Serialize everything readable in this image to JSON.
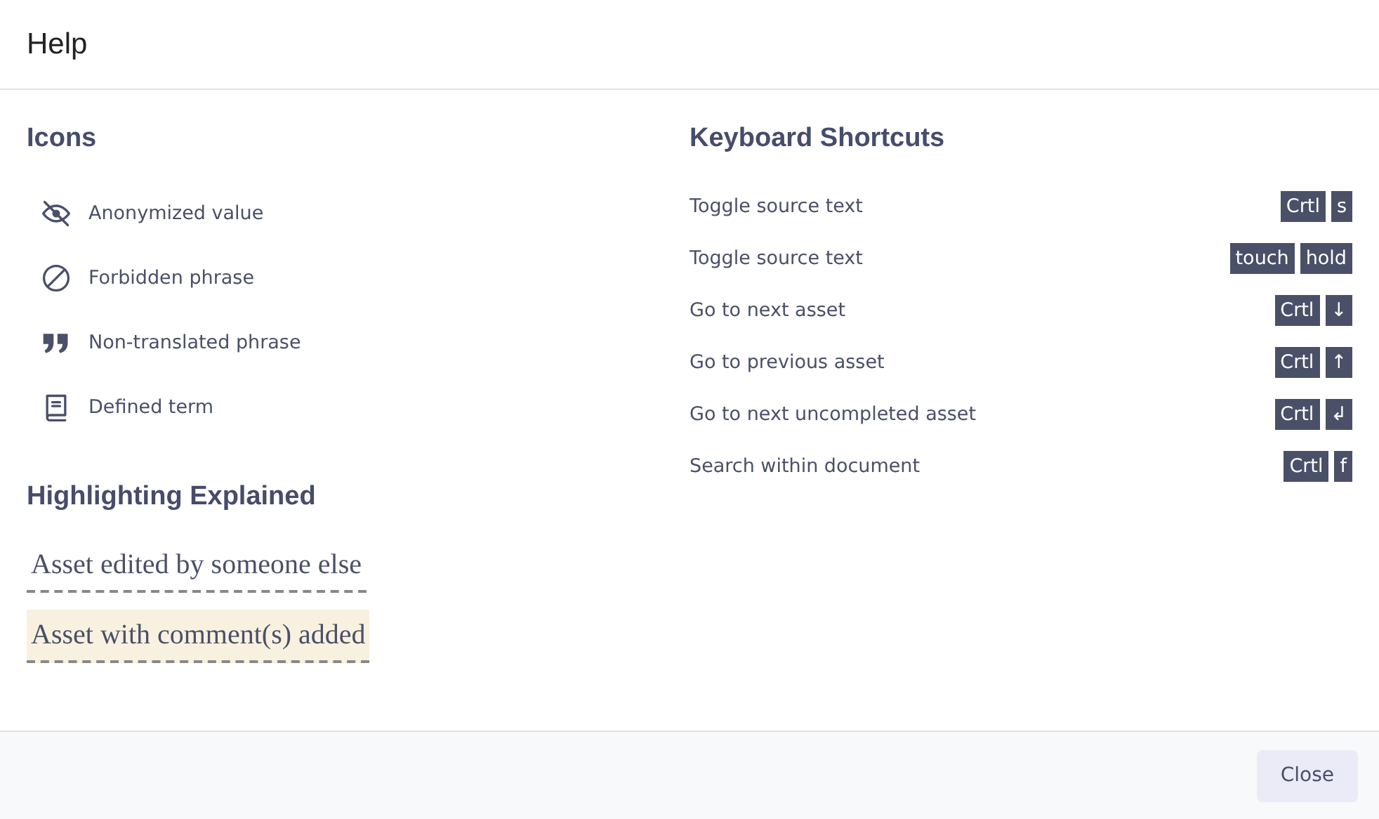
{
  "window": {
    "title": "Help"
  },
  "icons_section": {
    "title": "Icons",
    "items": [
      {
        "kind": "eye-off",
        "label": "Anonymized value"
      },
      {
        "kind": "forbidden",
        "label": "Forbidden phrase"
      },
      {
        "kind": "quote",
        "label": "Non-translated phrase"
      },
      {
        "kind": "book",
        "label": "Defined term"
      }
    ]
  },
  "highlighting_section": {
    "title": "Highlighting Explained",
    "items": [
      {
        "kind": "edited",
        "label": "Asset edited by someone else"
      },
      {
        "kind": "commented",
        "label": "Asset with comment(s) added"
      }
    ]
  },
  "shortcuts_section": {
    "title": "Keyboard Shortcuts",
    "items": [
      {
        "label": "Toggle source text",
        "keys": [
          "Crtl",
          "s"
        ]
      },
      {
        "label": "Toggle source text",
        "keys": [
          "touch",
          "hold"
        ]
      },
      {
        "label": "Go to next asset",
        "keys": [
          "Crtl",
          "↓"
        ]
      },
      {
        "label": "Go to previous asset",
        "keys": [
          "Crtl",
          "↑"
        ]
      },
      {
        "label": "Go to next uncompleted asset",
        "keys": [
          "Crtl",
          "↲"
        ]
      },
      {
        "label": "Search within document",
        "keys": [
          "Crtl",
          "f"
        ]
      }
    ]
  },
  "footer": {
    "buttons": [
      "Close"
    ]
  }
}
